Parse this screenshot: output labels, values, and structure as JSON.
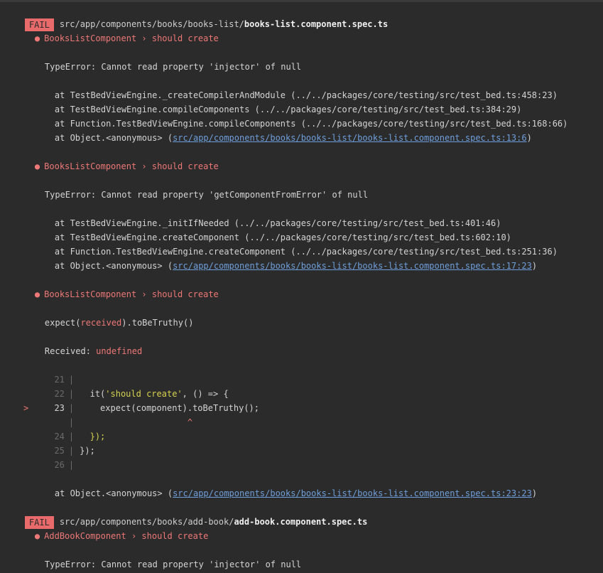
{
  "suites": [
    {
      "status": "FAIL",
      "path_prefix": "src/app/components/books/books-list/",
      "file_name": "books-list.component.spec.ts"
    },
    {
      "status": "FAIL",
      "path_prefix": "src/app/components/books/add-book/",
      "file_name": "add-book.component.spec.ts"
    }
  ],
  "failures": [
    {
      "title": "BooksListComponent › should create",
      "error": "TypeError: Cannot read property 'injector' of null",
      "stack": [
        "at TestBedViewEngine._createCompilerAndModule (../../packages/core/testing/src/test_bed.ts:458:23)",
        "at TestBedViewEngine.compileComponents (../../packages/core/testing/src/test_bed.ts:384:29)",
        "at Function.TestBedViewEngine.compileComponents (../../packages/core/testing/src/test_bed.ts:168:66)"
      ],
      "anon_prefix": "at Object.<anonymous> (",
      "anon_link": "src/app/components/books/books-list/books-list.component.spec.ts:13:6",
      "anon_suffix": ")"
    },
    {
      "title": "BooksListComponent › should create",
      "error": "TypeError: Cannot read property 'getComponentFromError' of null",
      "stack": [
        "at TestBedViewEngine._initIfNeeded (../../packages/core/testing/src/test_bed.ts:401:46)",
        "at TestBedViewEngine.createComponent (../../packages/core/testing/src/test_bed.ts:602:10)",
        "at Function.TestBedViewEngine.createComponent (../../packages/core/testing/src/test_bed.ts:251:36)"
      ],
      "anon_prefix": "at Object.<anonymous> (",
      "anon_link": "src/app/components/books/books-list/books-list.component.spec.ts:17:23",
      "anon_suffix": ")"
    },
    {
      "title": "BooksListComponent › should create",
      "expect_a": "expect(",
      "expect_b": "received",
      "expect_c": ").toBeTruthy()",
      "received_label": "Received: ",
      "received_value": "undefined",
      "anon_prefix": "at Object.<anonymous> (",
      "anon_link": "src/app/components/books/books-list/books-list.component.spec.ts:23:23",
      "anon_suffix": ")"
    },
    {
      "title": "AddBookComponent › should create",
      "error": "TypeError: Cannot read property 'injector' of null"
    }
  ],
  "bullet": "●",
  "code": {
    "marker": ">",
    "bar": "|",
    "caret": "^",
    "lines": [
      {
        "no": "21",
        "text": ""
      },
      {
        "no": "22",
        "pre": "it(",
        "str": "'should create'",
        "post": ", () => {"
      },
      {
        "no": "23",
        "text": "  expect(component).toBeTruthy();"
      },
      {
        "no": "",
        "text": ""
      },
      {
        "no": "24",
        "text": "});"
      },
      {
        "no": "25",
        "text": "});"
      },
      {
        "no": "26",
        "text": ""
      }
    ]
  }
}
